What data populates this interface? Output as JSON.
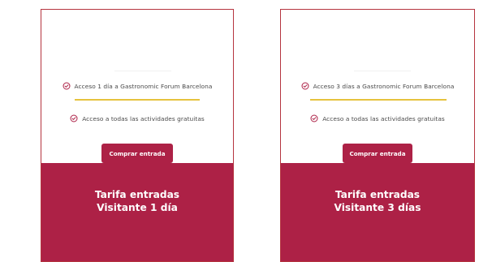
{
  "cards": [
    {
      "features": [
        "Acceso 1 día a Gastronomic Forum Barcelona",
        "Acceso a todas las actividades gratuitas"
      ],
      "button_label": "Comprar entrada",
      "title_line1": "Tarifa entradas",
      "title_line2": "Visitante 1 día"
    },
    {
      "features": [
        "Acceso 3 días a Gastronomic Forum Barcelona",
        "Acceso a todas las actividades gratuitas"
      ],
      "button_label": "Comprar entrada",
      "title_line1": "Tarifa entradas",
      "title_line2": "Visitante 3 días"
    }
  ],
  "colors": {
    "brand": "#ad2146",
    "accent_divider": "#e6c33d",
    "card_border": "#b5343f",
    "text": "#4a4a4a"
  },
  "icons": {
    "feature_icon": "check-circle-icon"
  }
}
